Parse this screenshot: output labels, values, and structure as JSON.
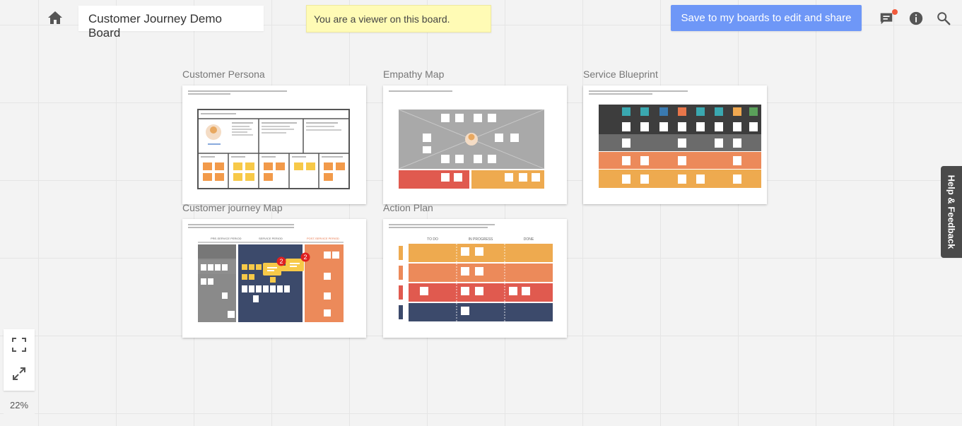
{
  "header": {
    "board_title": "Customer Journey Demo Board",
    "viewer_notice": "You are a viewer on this board.",
    "save_button": "Save to my boards to edit and share"
  },
  "icons": {
    "home": "home-icon",
    "comments": "comments-icon",
    "info": "info-icon",
    "search": "search-icon",
    "fit_screen": "fit-to-screen-icon",
    "fullscreen": "fullscreen-icon"
  },
  "frames": [
    {
      "title": "Customer Persona"
    },
    {
      "title": "Empathy Map"
    },
    {
      "title": "Service Blueprint"
    },
    {
      "title": "Customer journey Map"
    },
    {
      "title": "Action Plan"
    }
  ],
  "journey_map": {
    "stage_pre": "PRE-SERVICE PERIOD",
    "stage_service": "SERVICE PERIOD",
    "stage_post": "POST-SERVICE PERIOD",
    "comment_counts": [
      "2",
      "2"
    ]
  },
  "action_plan": {
    "columns": [
      "TO DO",
      "IN PROGRESS",
      "DONE"
    ]
  },
  "help_tab": "Help & Feedback",
  "zoom": {
    "level": "22%"
  },
  "colors": {
    "accent": "#6e97f7",
    "notice": "#fffbb5",
    "notification": "#f25a3c",
    "sticky_orange": "#f29a4a",
    "sticky_yellow": "#f7c948",
    "band_red": "#e05a4f",
    "band_orange": "#ec8a5a",
    "band_amber": "#eeaa4f",
    "band_navy": "#3c4a6b"
  }
}
